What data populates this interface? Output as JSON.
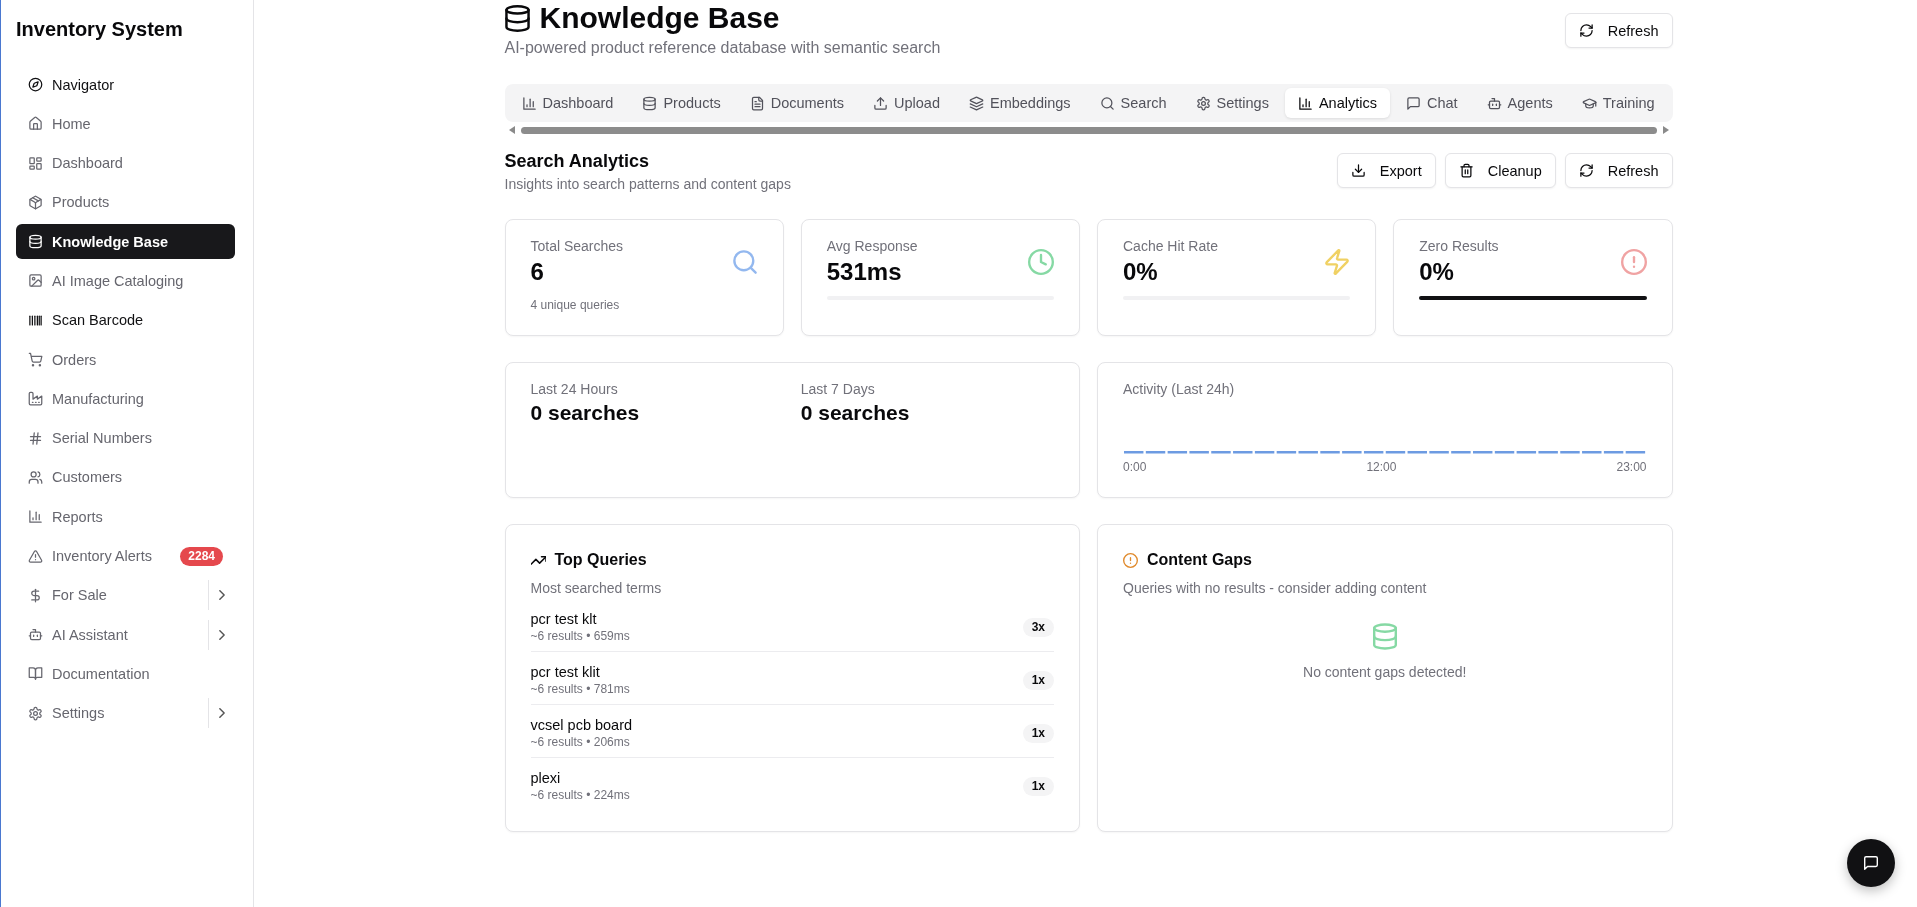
{
  "sidebar": {
    "title": "Inventory System",
    "items": [
      {
        "label": "Navigator",
        "selected": false,
        "emphasized": true,
        "submenu": false
      },
      {
        "label": "Home",
        "selected": false,
        "emphasized": false,
        "submenu": false
      },
      {
        "label": "Dashboard",
        "selected": false,
        "emphasized": false,
        "submenu": false
      },
      {
        "label": "Products",
        "selected": false,
        "emphasized": false,
        "submenu": false
      },
      {
        "label": "Knowledge Base",
        "selected": true,
        "emphasized": false,
        "submenu": false
      },
      {
        "label": "AI Image Cataloging",
        "selected": false,
        "emphasized": false,
        "submenu": false
      },
      {
        "label": "Scan Barcode",
        "selected": false,
        "emphasized": true,
        "submenu": false
      },
      {
        "label": "Orders",
        "selected": false,
        "emphasized": false,
        "submenu": false
      },
      {
        "label": "Manufacturing",
        "selected": false,
        "emphasized": false,
        "submenu": false
      },
      {
        "label": "Serial Numbers",
        "selected": false,
        "emphasized": false,
        "submenu": false
      },
      {
        "label": "Customers",
        "selected": false,
        "emphasized": false,
        "submenu": false
      },
      {
        "label": "Reports",
        "selected": false,
        "emphasized": false,
        "submenu": false
      },
      {
        "label": "Inventory Alerts",
        "selected": false,
        "emphasized": false,
        "submenu": false,
        "badge": "2284"
      },
      {
        "label": "For Sale",
        "selected": false,
        "emphasized": false,
        "submenu": true
      },
      {
        "label": "AI Assistant",
        "selected": false,
        "emphasized": false,
        "submenu": true
      },
      {
        "label": "Documentation",
        "selected": false,
        "emphasized": false,
        "submenu": false
      },
      {
        "label": "Settings",
        "selected": false,
        "emphasized": false,
        "submenu": true
      }
    ]
  },
  "header": {
    "title": "Knowledge Base",
    "subtitle": "AI-powered product reference database with semantic search",
    "refresh_button": "Refresh"
  },
  "tabs": [
    {
      "label": "Dashboard",
      "selected": false
    },
    {
      "label": "Products",
      "selected": false
    },
    {
      "label": "Documents",
      "selected": false
    },
    {
      "label": "Upload",
      "selected": false
    },
    {
      "label": "Embeddings",
      "selected": false
    },
    {
      "label": "Search",
      "selected": false
    },
    {
      "label": "Settings",
      "selected": false
    },
    {
      "label": "Analytics",
      "selected": true
    },
    {
      "label": "Chat",
      "selected": false
    },
    {
      "label": "Agents",
      "selected": false
    },
    {
      "label": "Training",
      "selected": false
    }
  ],
  "section": {
    "title": "Search Analytics",
    "subtitle": "Insights into search patterns and content gaps",
    "buttons": [
      "Export",
      "Cleanup",
      "Refresh"
    ]
  },
  "stats": [
    {
      "label": "Total Searches",
      "value": "6",
      "note": "4 unique queries",
      "color": "#93b8ef"
    },
    {
      "label": "Avg Response",
      "value": "531ms",
      "level": 0,
      "color": "#86d9a4"
    },
    {
      "label": "Cache Hit Rate",
      "value": "0%",
      "level": 0,
      "color": "#f0d163"
    },
    {
      "label": "Zero Results",
      "value": "0%",
      "level": 1,
      "color": "#f0a3a3"
    }
  ],
  "periods": [
    {
      "label": "Last 24 Hours",
      "value": "0 searches"
    },
    {
      "label": "Last 7 Days",
      "value": "0 searches"
    }
  ],
  "activity": {
    "title": "Activity (Last 24h)",
    "axis_labels": [
      "0:00",
      "12:00",
      "23:00"
    ]
  },
  "top_queries": {
    "title": "Top Queries",
    "subtitle": "Most searched terms",
    "rows": [
      {
        "query": "pcr test klt",
        "meta": "~6 results • 659ms",
        "count": "3x"
      },
      {
        "query": "pcr test klit",
        "meta": "~6 results • 781ms",
        "count": "1x"
      },
      {
        "query": "vcsel pcb board",
        "meta": "~6 results • 206ms",
        "count": "1x"
      },
      {
        "query": "plexi",
        "meta": "~6 results • 224ms",
        "count": "1x"
      }
    ]
  },
  "content_gaps": {
    "title": "Content Gaps",
    "subtitle": "Queries with no results - consider adding content",
    "empty_message": "No content gaps detected!"
  }
}
